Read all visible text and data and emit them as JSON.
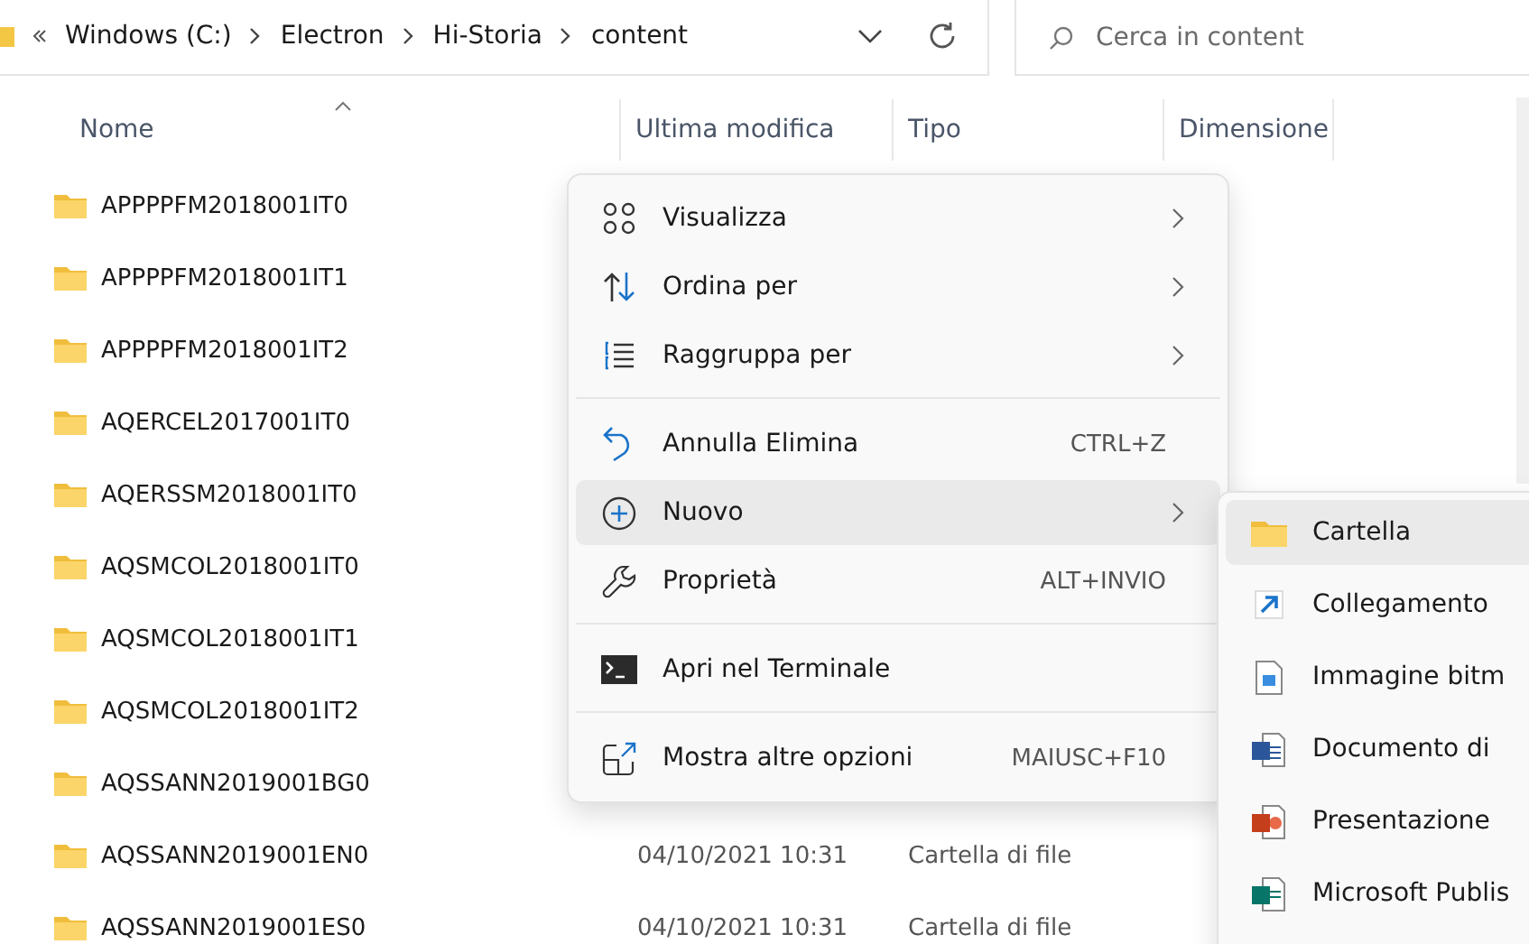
{
  "address_bar": {
    "path": [
      "Windows (C:)",
      "Electron",
      "Hi-Storia",
      "content"
    ]
  },
  "search": {
    "placeholder": "Cerca in content"
  },
  "table": {
    "columns": [
      "Nome",
      "Ultima modifica",
      "Tipo",
      "Dimensione"
    ],
    "rows": [
      {
        "name": "APPPPFM2018001IT0"
      },
      {
        "name": "APPPPFM2018001IT1"
      },
      {
        "name": "APPPPFM2018001IT2"
      },
      {
        "name": "AQERCEL2017001IT0"
      },
      {
        "name": "AQERSSM2018001IT0"
      },
      {
        "name": "AQSMCOL2018001IT0"
      },
      {
        "name": "AQSMCOL2018001IT1"
      },
      {
        "name": "AQSMCOL2018001IT2"
      },
      {
        "name": "AQSSANN2019001BG0"
      },
      {
        "name": "AQSSANN2019001EN0",
        "modified": "04/10/2021 10:31",
        "type": "Cartella di file"
      },
      {
        "name": "AQSSANN2019001ES0",
        "modified": "04/10/2021 10:31",
        "type": "Cartella di file"
      }
    ]
  },
  "context_menu": {
    "groups": [
      [
        {
          "kind": "grid",
          "label": "Visualizza",
          "submenu": true,
          "selected": false
        },
        {
          "kind": "sort",
          "label": "Ordina per",
          "submenu": true,
          "selected": false
        },
        {
          "kind": "group",
          "label": "Raggruppa per",
          "submenu": true,
          "selected": false
        }
      ],
      [
        {
          "kind": "undo",
          "label": "Annulla Elimina",
          "shortcut": "CTRL+Z",
          "submenu": false,
          "selected": false
        },
        {
          "kind": "new",
          "label": "Nuovo",
          "submenu": true,
          "selected": true
        },
        {
          "kind": "wrench",
          "label": "Proprietà",
          "shortcut": "ALT+INVIO",
          "submenu": false,
          "selected": false
        }
      ],
      [
        {
          "kind": "terminal",
          "label": "Apri nel Terminale",
          "submenu": false,
          "selected": false
        }
      ],
      [
        {
          "kind": "more",
          "label": "Mostra altre opzioni",
          "shortcut": "MAIUSC+F10",
          "submenu": false,
          "selected": false
        }
      ]
    ]
  },
  "submenu": {
    "items": [
      {
        "kind": "folder",
        "label": "Cartella",
        "selected": true
      },
      {
        "kind": "shortcut",
        "label": "Collegamento",
        "selected": false
      },
      {
        "kind": "bitmap",
        "label": "Immagine bitm",
        "selected": false
      },
      {
        "kind": "word",
        "label": "Documento di",
        "selected": false
      },
      {
        "kind": "powerpoint",
        "label": "Presentazione",
        "selected": false
      },
      {
        "kind": "publisher",
        "label": "Microsoft Publis",
        "selected": false
      }
    ]
  }
}
